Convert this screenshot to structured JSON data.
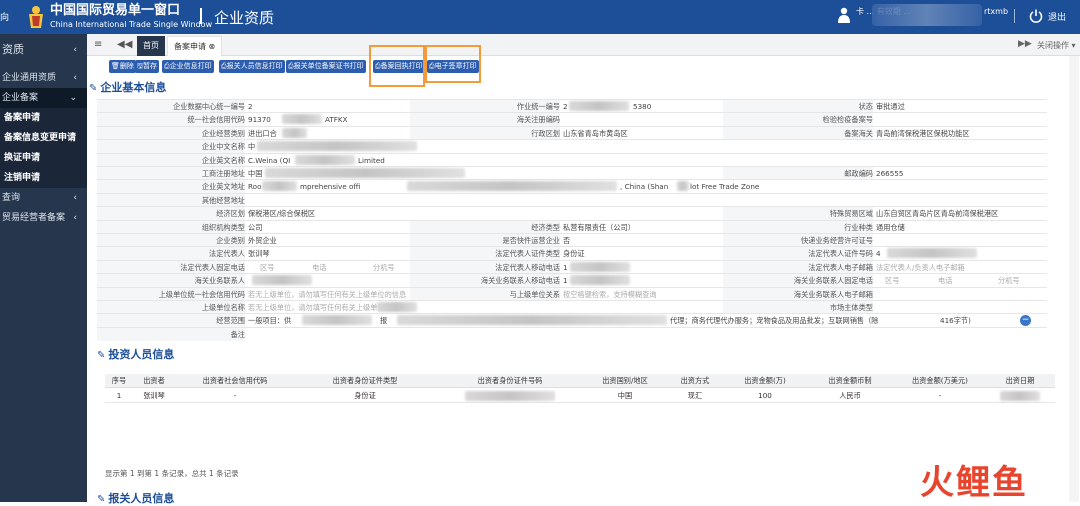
{
  "header": {
    "brand_cn": "中国国际贸易单一窗口",
    "brand_en": "China International Trade Single Window",
    "module_title": "企业资质",
    "corner_text": "向",
    "user_text": "卡 ... 有效期 ...",
    "user_tail": "rtxmb",
    "logout": "退出"
  },
  "sidebar": {
    "title": "资质",
    "items": [
      "企业通用资质",
      "企业备案",
      "备案申请",
      "备案信息变更申请",
      "换证申请",
      "注销申请",
      "查询",
      "贸易经营者备案"
    ]
  },
  "tabbar": {
    "home": "首页",
    "current": "备案申请",
    "close_ops": "关闭操作"
  },
  "toolbar": {
    "buttons": [
      "删除",
      "暂存",
      "企业信息打印",
      "报关人员信息打印",
      "报关单位备案证书打印",
      "备案回执打印",
      "电子签章打印"
    ]
  },
  "sections": {
    "basic": "企业基本信息",
    "investor": "投资人员信息",
    "customs_staff": "报关人员信息"
  },
  "form": {
    "r1": [
      "企业数据中心统一编号",
      "2",
      "作业统一编号",
      "2",
      "5380",
      "状态",
      "审批通过"
    ],
    "r2": [
      "统一社会信用代码",
      "91370",
      "ATFKX",
      "海关注册编码",
      "检验检疫备案号"
    ],
    "r3": [
      "企业经营类别",
      "进出口合",
      "行政区划",
      "山东省青岛市黄岛区",
      "备案海关",
      "青岛前湾保税港区保税功能区"
    ],
    "r4": [
      "企业中文名称",
      "中"
    ],
    "r5": [
      "企业英文名称",
      "C.Weina (QI",
      "Limited"
    ],
    "r6": [
      "工商注册地址",
      "中国",
      "邮政编码",
      "266555"
    ],
    "r7": [
      "企业英文地址",
      "Roo",
      "mprehensive offi",
      ", China (Shan",
      "lot Free Trade Zone"
    ],
    "r8": [
      "其他经营地址"
    ],
    "r9": [
      "经济区划",
      "保税港区/综合保税区",
      "特殊贸易区域",
      "山东自贸区青岛片区青岛前湾保税港区"
    ],
    "r10": [
      "组织机构类型",
      "公司",
      "经济类型",
      "私营有限责任（公司）",
      "行业种类",
      "通用仓储"
    ],
    "r11": [
      "企业类别",
      "外贸企业",
      "是否快件运营企业",
      "否",
      "快递业务经营许可证号"
    ],
    "r12": [
      "法定代表人",
      "张训琴",
      "法定代表人证件类型",
      "身份证",
      "法定代表人证件号码",
      "4"
    ],
    "r13": [
      "法定代表人固定电话",
      "区号",
      "电话",
      "分机号",
      "法定代表人移动电话",
      "1",
      "法定代表人电子邮箱",
      "法定代表人/负责人电子邮箱"
    ],
    "r14": [
      "海关业务联系人",
      "海关业务联系人移动电话",
      "1",
      "海关业务联系人固定电话",
      "区号",
      "电话",
      "分机号"
    ],
    "r15": [
      "上级单位统一社会信用代码",
      "若无上级单位，请勿填写任何有关上级单位的信息",
      "与上级单位关系",
      "按空格键检索，支持模糊查询",
      "海关业务联系人电子邮箱"
    ],
    "r16": [
      "上级单位名称",
      "若无上级单位，请勿填写任何有关上级单位的",
      "市场主体类型"
    ],
    "r17": [
      "经营范围",
      "一般项目：供",
      "报",
      "代理；商务代理代办服务；宠物食品及用品批发；互联网销售（除",
      "416字节)"
    ],
    "r18": [
      "备注"
    ]
  },
  "investor_table": {
    "headers": [
      "序号",
      "出资者",
      "出资者社会信用代码",
      "出资者身份证件类型",
      "出资者身份证件号码",
      "出资国别/地区",
      "出资方式",
      "出资金额(万)",
      "出资金额币制",
      "出资金额(万美元)",
      "出资日期"
    ],
    "rows": [
      [
        "1",
        "张训琴",
        "-",
        "身份证",
        "",
        "中国",
        "现汇",
        "100",
        "人民币",
        "-",
        ""
      ]
    ],
    "footnote": "显示第 1 到第 1 条记录，总共 1 条记录"
  },
  "watermark": "火鲤鱼",
  "colors": {
    "topbar": "#1d4f99",
    "sidebar": "#26364d",
    "button": "#2c5dae",
    "highlight": "#f39a3a"
  }
}
